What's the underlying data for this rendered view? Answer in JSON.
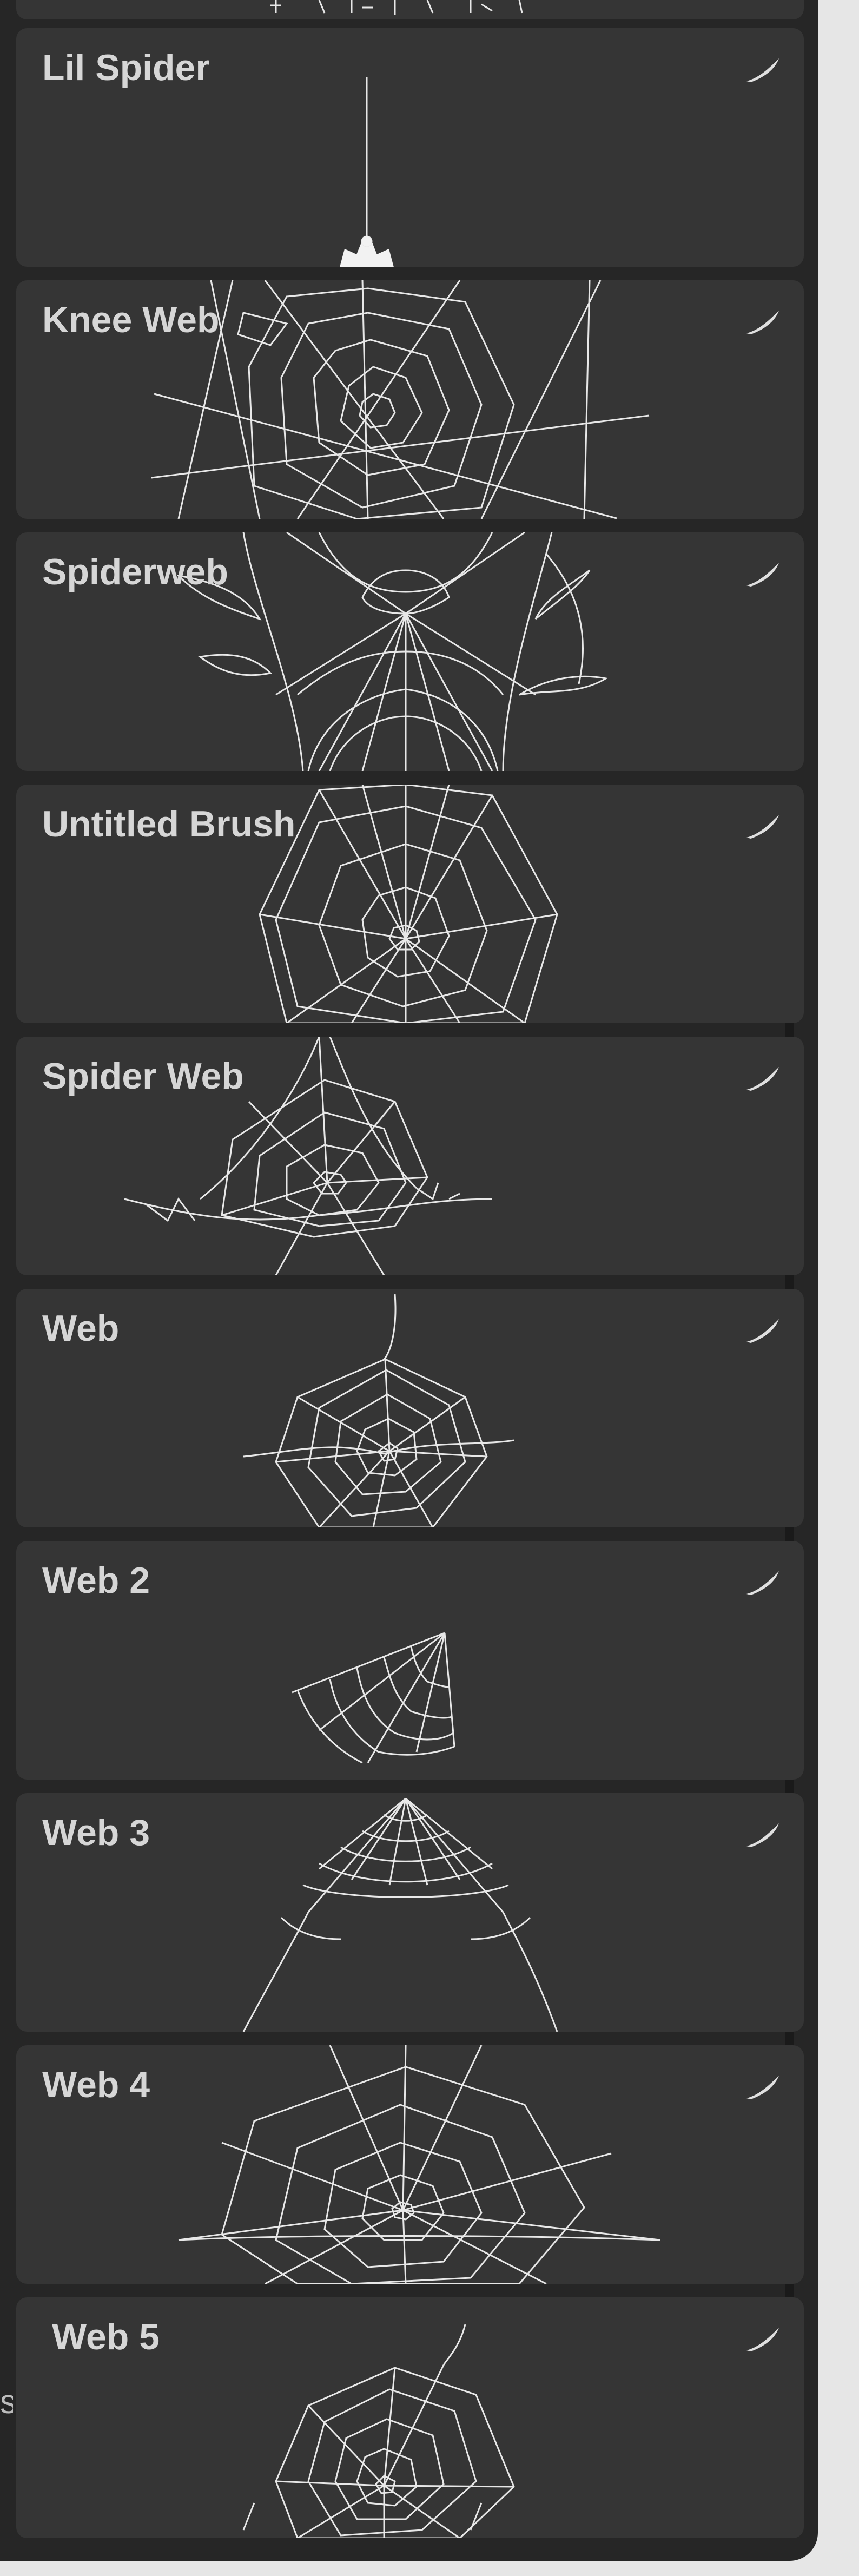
{
  "edge_fragment": "s",
  "brushes": [
    {
      "name": "Lil Spider",
      "icon": "stroke-icon"
    },
    {
      "name": "Knee Web",
      "icon": "stroke-icon"
    },
    {
      "name": "Spiderweb",
      "icon": "stroke-icon"
    },
    {
      "name": "Untitled Brush",
      "icon": "stroke-icon"
    },
    {
      "name": "Spider Web",
      "icon": "stroke-icon"
    },
    {
      "name": "Web",
      "icon": "stroke-icon"
    },
    {
      "name": "Web 2",
      "icon": "stroke-icon"
    },
    {
      "name": "Web 3",
      "icon": "stroke-icon"
    },
    {
      "name": "Web 4",
      "icon": "stroke-icon"
    },
    {
      "name": "Web 5",
      "icon": "stroke-icon"
    }
  ],
  "colors": {
    "card": "#353535",
    "panel": "#262626",
    "label": "#d6d6d6",
    "stroke": "#e8e8e8"
  }
}
